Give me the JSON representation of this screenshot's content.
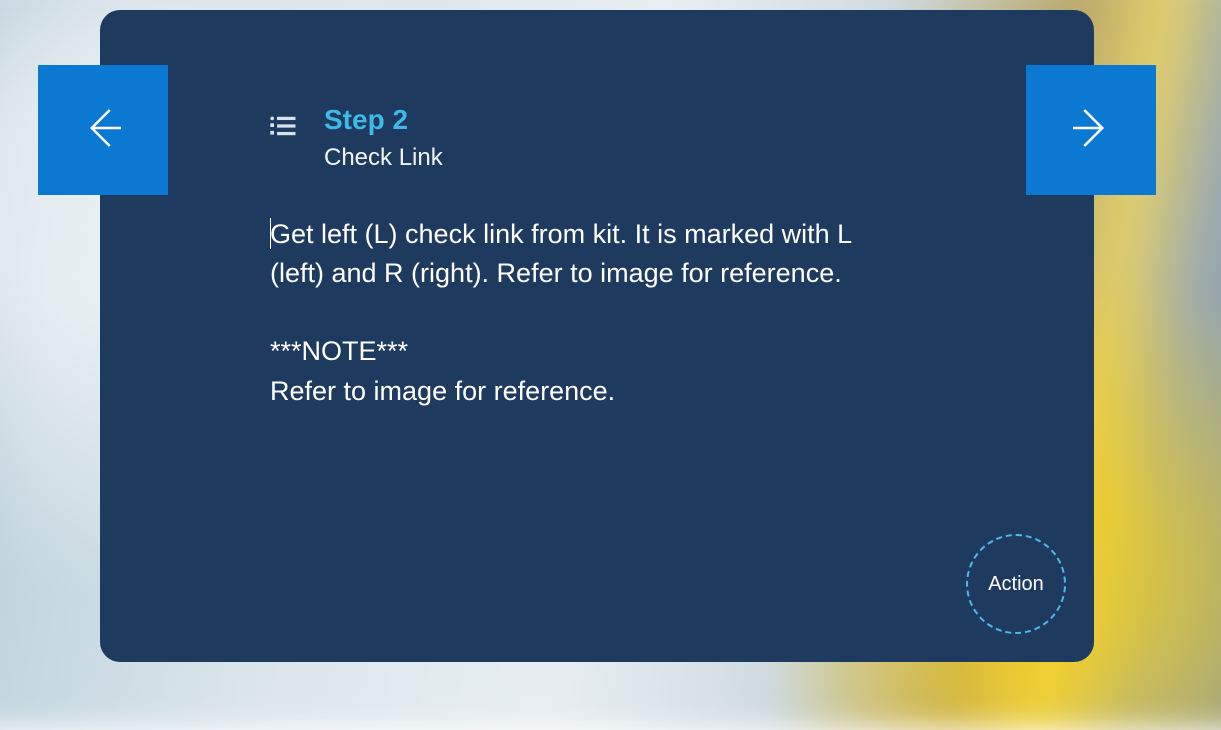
{
  "step": {
    "label": "Step 2",
    "title": "Check Link"
  },
  "instructions": "Get left (L) check link from kit. It is marked with L (left) and R (right). Refer to image for reference.\n\n***NOTE***\nRefer to image for reference.",
  "action_button_label": "Action",
  "colors": {
    "card_bg": "#1e3a5f",
    "nav_button": "#0b78d1",
    "accent": "#3fb9e6"
  }
}
